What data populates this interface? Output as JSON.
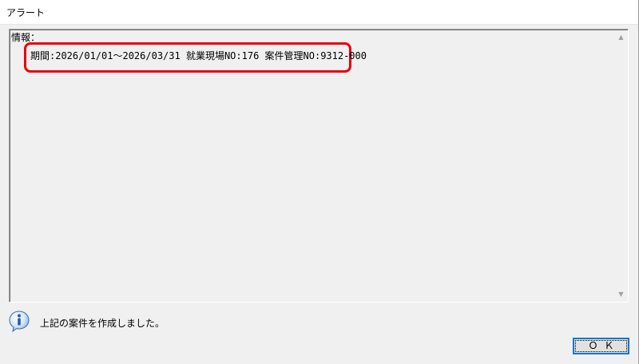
{
  "window": {
    "title": "アラート"
  },
  "info": {
    "label": "情報：",
    "line": "期間:2026/01/01～2026/03/31  就業現場NO:176  案件管理NO:9312-000",
    "highlight_color": "#e8000b"
  },
  "message": {
    "icon": "info-icon",
    "text": "上記の案件を作成しました。"
  },
  "buttons": {
    "ok_label": "ＯＫ"
  },
  "colors": {
    "accent": "#0078d7",
    "icon_blue": "#1f5fa8"
  }
}
